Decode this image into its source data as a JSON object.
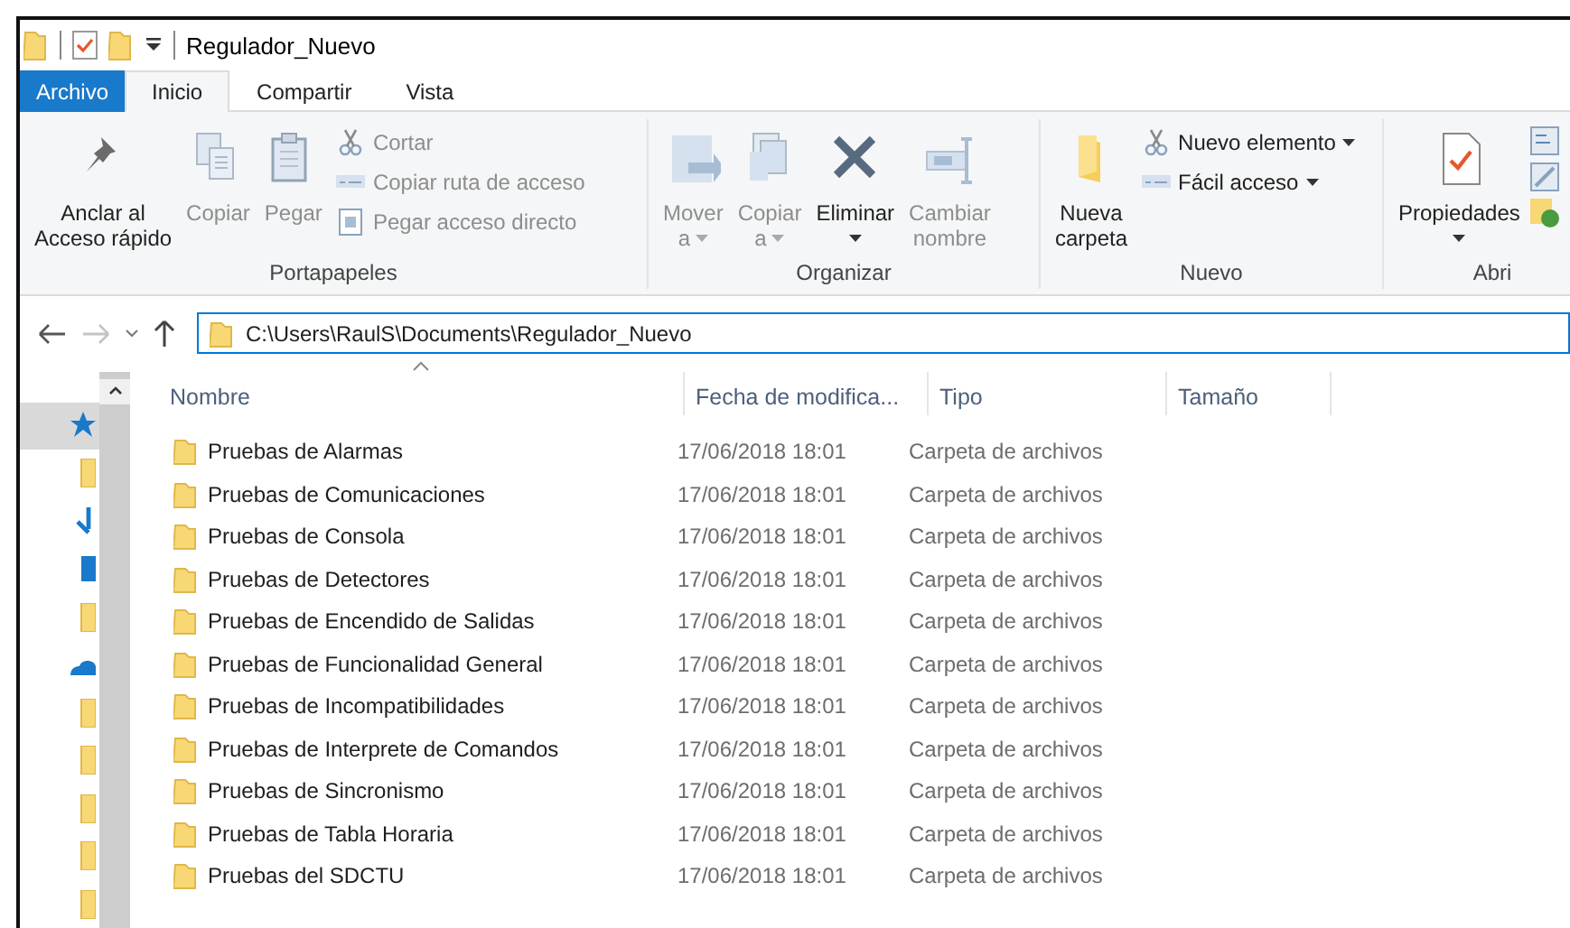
{
  "window": {
    "title": "Regulador_Nuevo"
  },
  "ribbon_tabs": [
    {
      "label": "Archivo",
      "kind": "file",
      "selected": false
    },
    {
      "label": "Inicio",
      "kind": "tab",
      "selected": true
    },
    {
      "label": "Compartir",
      "kind": "tab",
      "selected": false
    },
    {
      "label": "Vista",
      "kind": "tab",
      "selected": false
    }
  ],
  "ribbon_groups": [
    {
      "label": "Portapapeles",
      "items": [
        {
          "kind": "large",
          "lines": [
            "Anclar al",
            "Acceso rápido"
          ],
          "disabled": false,
          "dropdown": false
        },
        {
          "kind": "large",
          "lines": [
            "Copiar"
          ],
          "disabled": true,
          "dropdown": false
        },
        {
          "kind": "large",
          "lines": [
            "Pegar"
          ],
          "disabled": true,
          "dropdown": false
        },
        {
          "kind": "stack",
          "items": [
            {
              "label": "Cortar",
              "disabled": true,
              "dropdown": false
            },
            {
              "label": "Copiar ruta de acceso",
              "disabled": true,
              "dropdown": false
            },
            {
              "label": "Pegar acceso directo",
              "disabled": true,
              "dropdown": false
            }
          ]
        }
      ]
    },
    {
      "label": "Organizar",
      "items": [
        {
          "kind": "large",
          "lines": [
            "Mover",
            "a"
          ],
          "disabled": true,
          "dropdown": true
        },
        {
          "kind": "large",
          "lines": [
            "Copiar",
            "a"
          ],
          "disabled": true,
          "dropdown": true
        },
        {
          "kind": "large",
          "lines": [
            "Eliminar"
          ],
          "disabled": false,
          "dropdown": true
        },
        {
          "kind": "large",
          "lines": [
            "Cambiar",
            "nombre"
          ],
          "disabled": true,
          "dropdown": false
        }
      ]
    },
    {
      "label": "Nuevo",
      "items": [
        {
          "kind": "large",
          "lines": [
            "Nueva",
            "carpeta"
          ],
          "disabled": false,
          "dropdown": false
        },
        {
          "kind": "stack",
          "items": [
            {
              "label": "Nuevo elemento",
              "disabled": false,
              "dropdown": true
            },
            {
              "label": "Fácil acceso",
              "disabled": false,
              "dropdown": true
            }
          ]
        }
      ]
    },
    {
      "label": "Abri",
      "items": [
        {
          "kind": "large",
          "lines": [
            "Propiedades"
          ],
          "disabled": false,
          "dropdown": true
        },
        {
          "kind": "icons"
        }
      ]
    }
  ],
  "address": {
    "path": "C:\\Users\\RaulS\\Documents\\Regulador_Nuevo",
    "focused": true
  },
  "nav_pane": {
    "items": [
      {
        "selected": true
      },
      {
        "selected": false
      },
      {
        "selected": false
      },
      {
        "selected": false
      },
      {
        "selected": false
      },
      {
        "selected": false
      },
      {
        "selected": false
      },
      {
        "selected": false
      },
      {
        "selected": false
      },
      {
        "selected": false
      },
      {
        "selected": false
      }
    ]
  },
  "table": {
    "columns": [
      "Nombre",
      "Fecha de modifica...",
      "Tipo",
      "Tamaño"
    ],
    "rows": [
      {
        "name": "Pruebas de Alarmas",
        "date": "17/06/2018 18:01",
        "type": "Carpeta de archivos"
      },
      {
        "name": "Pruebas de Comunicaciones",
        "date": "17/06/2018 18:01",
        "type": "Carpeta de archivos"
      },
      {
        "name": "Pruebas de Consola",
        "date": "17/06/2018 18:01",
        "type": "Carpeta de archivos"
      },
      {
        "name": "Pruebas de Detectores",
        "date": "17/06/2018 18:01",
        "type": "Carpeta de archivos"
      },
      {
        "name": "Pruebas de Encendido de Salidas",
        "date": "17/06/2018 18:01",
        "type": "Carpeta de archivos"
      },
      {
        "name": "Pruebas de Funcionalidad General",
        "date": "17/06/2018 18:01",
        "type": "Carpeta de archivos"
      },
      {
        "name": "Pruebas de Incompatibilidades",
        "date": "17/06/2018 18:01",
        "type": "Carpeta de archivos"
      },
      {
        "name": "Pruebas de Interprete de Comandos",
        "date": "17/06/2018 18:01",
        "type": "Carpeta de archivos"
      },
      {
        "name": "Pruebas de Sincronismo",
        "date": "17/06/2018 18:01",
        "type": "Carpeta de archivos"
      },
      {
        "name": "Pruebas de Tabla Horaria",
        "date": "17/06/2018 18:01",
        "type": "Carpeta de archivos"
      },
      {
        "name": "Pruebas del SDCTU",
        "date": "17/06/2018 18:01",
        "type": "Carpeta de archivos"
      }
    ]
  }
}
